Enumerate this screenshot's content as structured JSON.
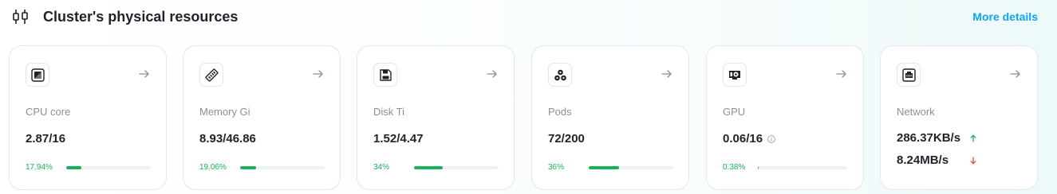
{
  "header": {
    "title": "Cluster's physical resources",
    "more_link": "More details",
    "icon": "sliders-icon"
  },
  "colors": {
    "accent_link": "#0ea5e9",
    "progress_fill": "#16b35a",
    "upload_arrow": "#16b35a",
    "download_arrow": "#ef4444"
  },
  "cards": [
    {
      "label": "CPU core",
      "value": "2.87/16",
      "percent": "17.94%",
      "fraction": 0.1794,
      "icon": "cpu-icon"
    },
    {
      "label": "Memory Gi",
      "value": "8.93/46.86",
      "percent": "19.06%",
      "fraction": 0.1906,
      "icon": "memory-icon"
    },
    {
      "label": "Disk Ti",
      "value": "1.52/4.47",
      "percent": "34%",
      "fraction": 0.34,
      "icon": "disk-icon"
    },
    {
      "label": "Pods",
      "value": "72/200",
      "percent": "36%",
      "fraction": 0.36,
      "icon": "pods-icon"
    },
    {
      "label": "GPU",
      "value": "0.06/16",
      "percent": "0.38%",
      "fraction": 0.0038,
      "icon": "gpu-icon"
    }
  ],
  "network": {
    "label": "Network",
    "upload": "286.37KB/s",
    "download": "8.24MB/s",
    "icon": "network-icon"
  }
}
